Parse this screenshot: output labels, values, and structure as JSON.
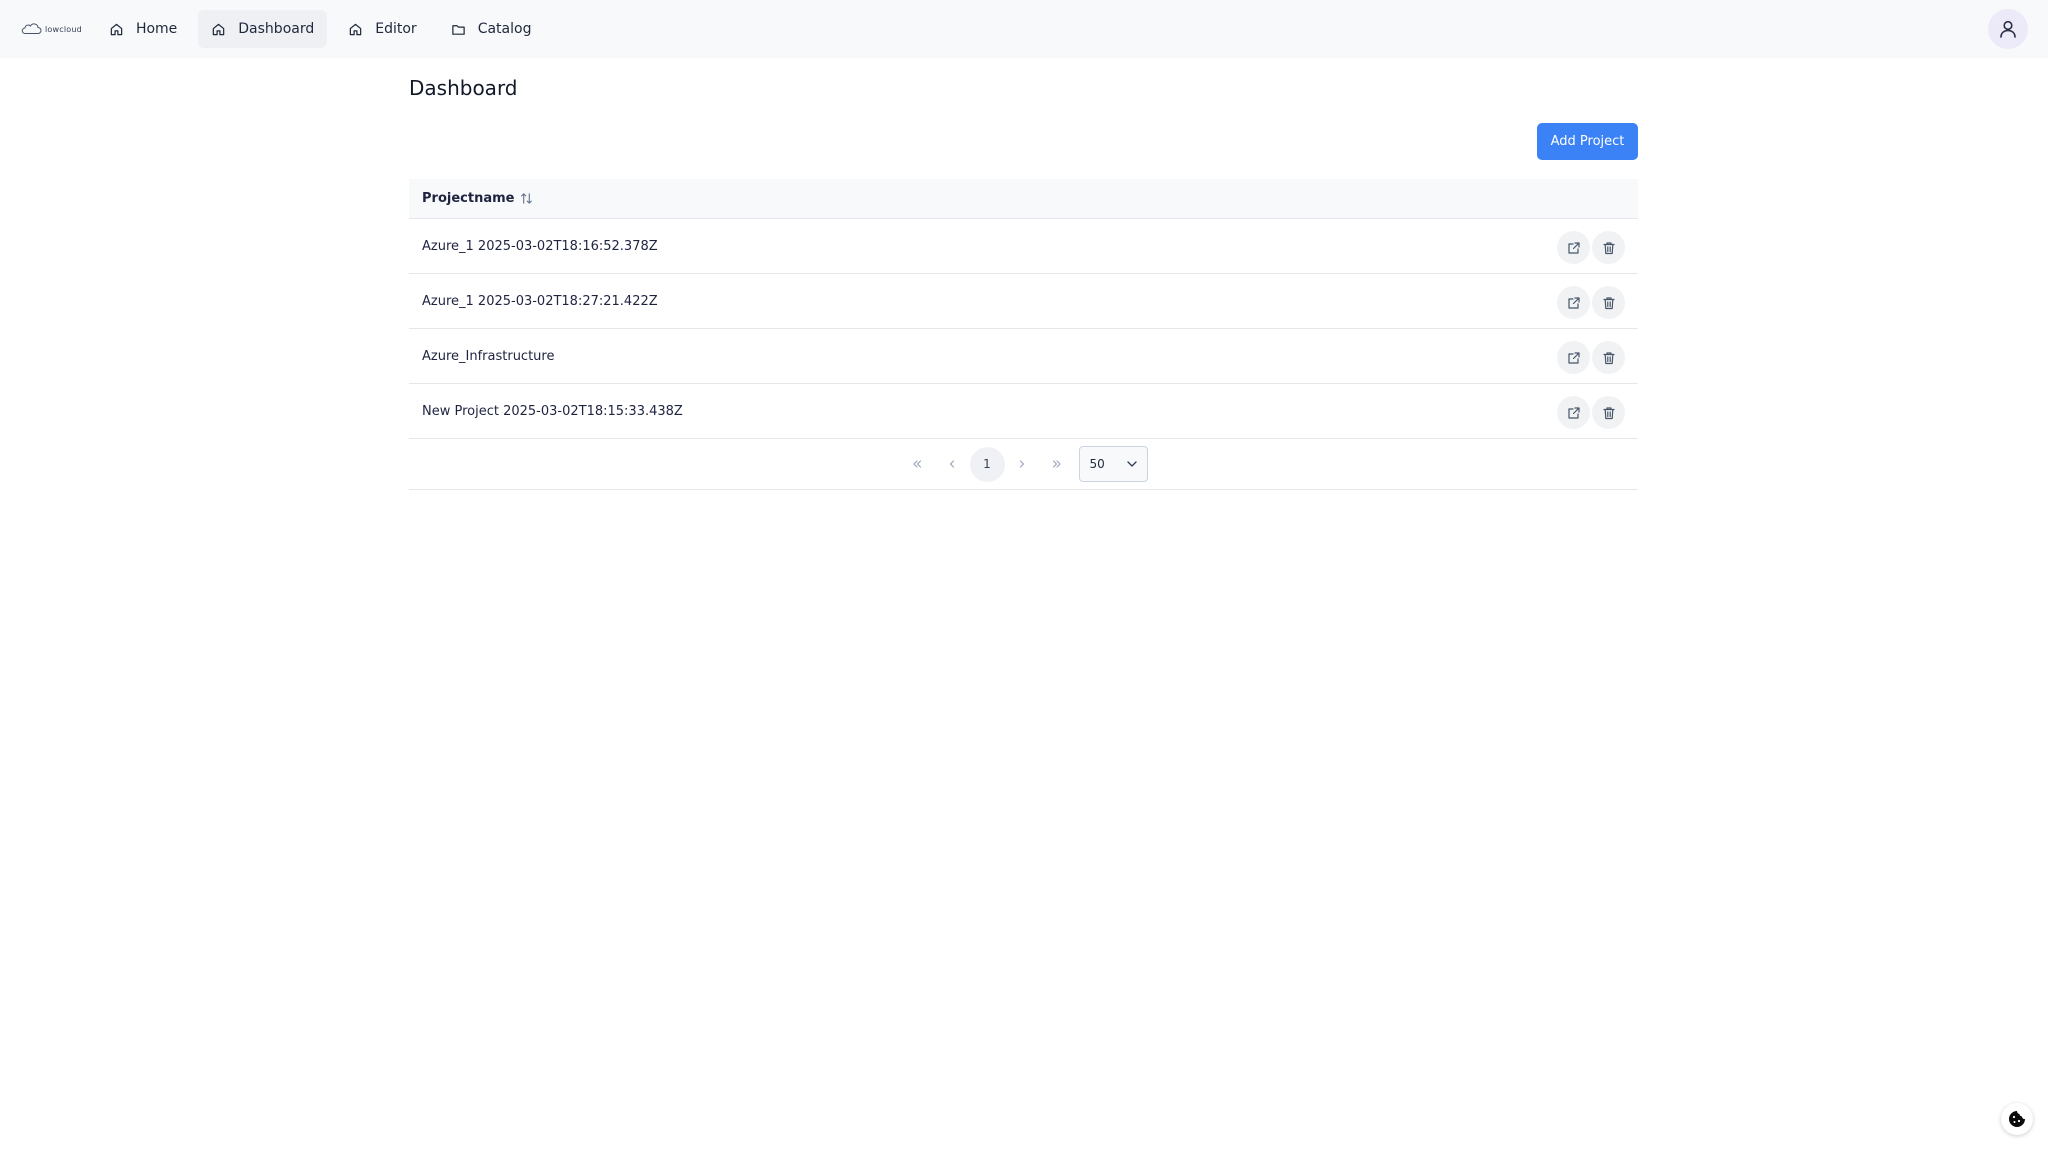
{
  "nav": {
    "brand": "lowcloud",
    "items": [
      {
        "label": "Home",
        "icon": "home-icon",
        "active": false
      },
      {
        "label": "Dashboard",
        "icon": "home-icon",
        "active": true
      },
      {
        "label": "Editor",
        "icon": "home-icon",
        "active": false
      },
      {
        "label": "Catalog",
        "icon": "folder-icon",
        "active": false
      }
    ],
    "user_icon": "user-icon"
  },
  "page": {
    "title": "Dashboard",
    "add_button": "Add Project"
  },
  "table": {
    "column_header": "Projectname",
    "rows": [
      {
        "name": "Azure_1 2025-03-02T18:16:52.378Z"
      },
      {
        "name": "Azure_1 2025-03-02T18:27:21.422Z"
      },
      {
        "name": "Azure_Infrastructure"
      },
      {
        "name": "New Project 2025-03-02T18:15:33.438Z"
      }
    ]
  },
  "pagination": {
    "current_page": "1",
    "page_size": "50"
  },
  "colors": {
    "accent": "#3b82f6",
    "nav_bg": "#f8f9fb"
  }
}
